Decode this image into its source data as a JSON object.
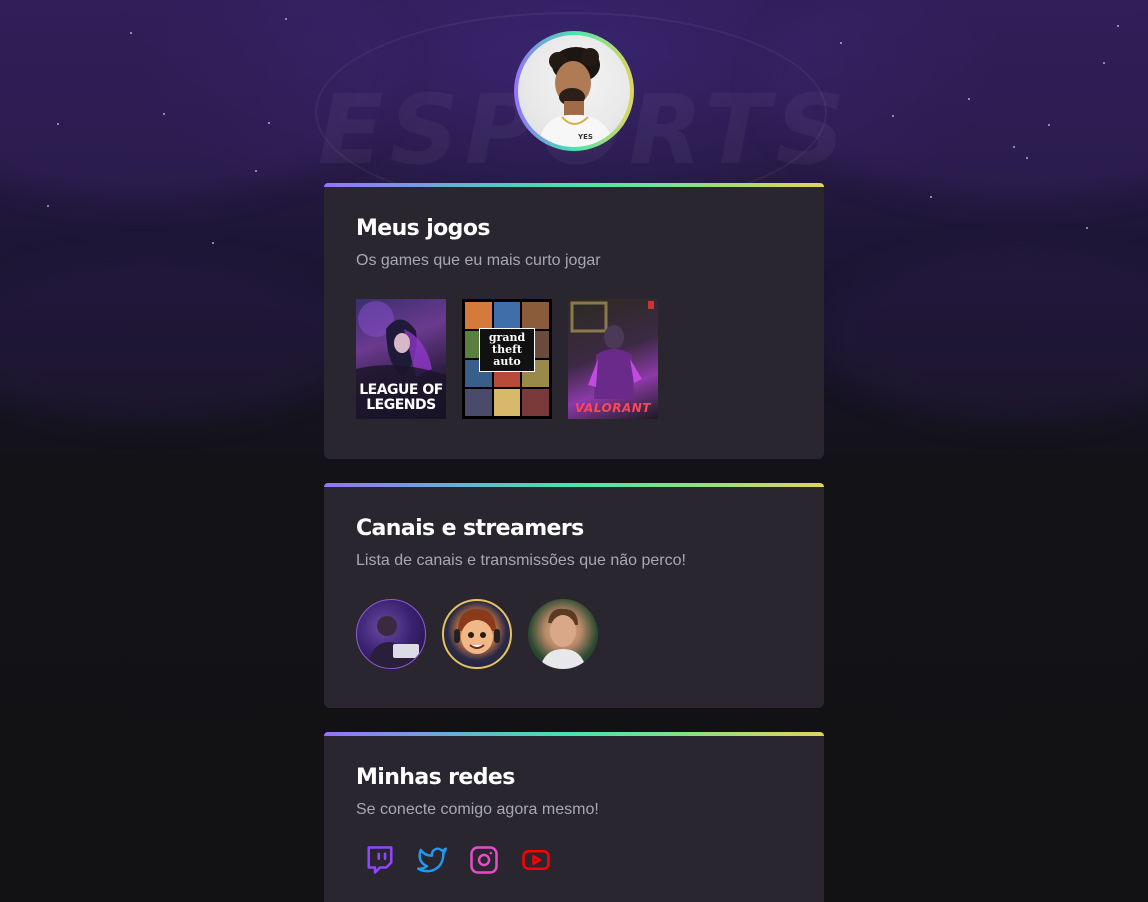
{
  "colors": {
    "accent_gradient": [
      "#9572fc",
      "#43e7ad",
      "#e2d45c"
    ],
    "card_bg": "#29262f",
    "page_bg": "#121214",
    "twitch": "#9146ff",
    "twitter": "#1d9bf0",
    "instagram": "#e64cc8",
    "youtube": "#ff0000"
  },
  "background": {
    "watermark_text": "ESPORTS"
  },
  "profile": {
    "avatar_icon": "profile-photo",
    "shirt_badge": "YES"
  },
  "sections": {
    "games": {
      "title": "Meus jogos",
      "subtitle": "Os games que eu mais curto jogar",
      "items": [
        {
          "name": "LEAGUE OF LEGENDS",
          "cover_text": "LEAGUE OF LEGENDS"
        },
        {
          "name": "GTA V",
          "cover_text": "grand theft auto"
        },
        {
          "name": "VALORANT",
          "cover_text": "VALORANT"
        }
      ]
    },
    "streamers": {
      "title": "Canais e streamers",
      "subtitle": "Lista de canais e transmissões que não perco!",
      "items": [
        "streamer-avatar-1",
        "streamer-avatar-2",
        "streamer-avatar-3"
      ]
    },
    "socials": {
      "title": "Minhas redes",
      "subtitle": "Se conecte comigo agora mesmo!",
      "items": [
        "twitch-icon",
        "twitter-icon",
        "instagram-icon",
        "youtube-icon"
      ]
    }
  }
}
